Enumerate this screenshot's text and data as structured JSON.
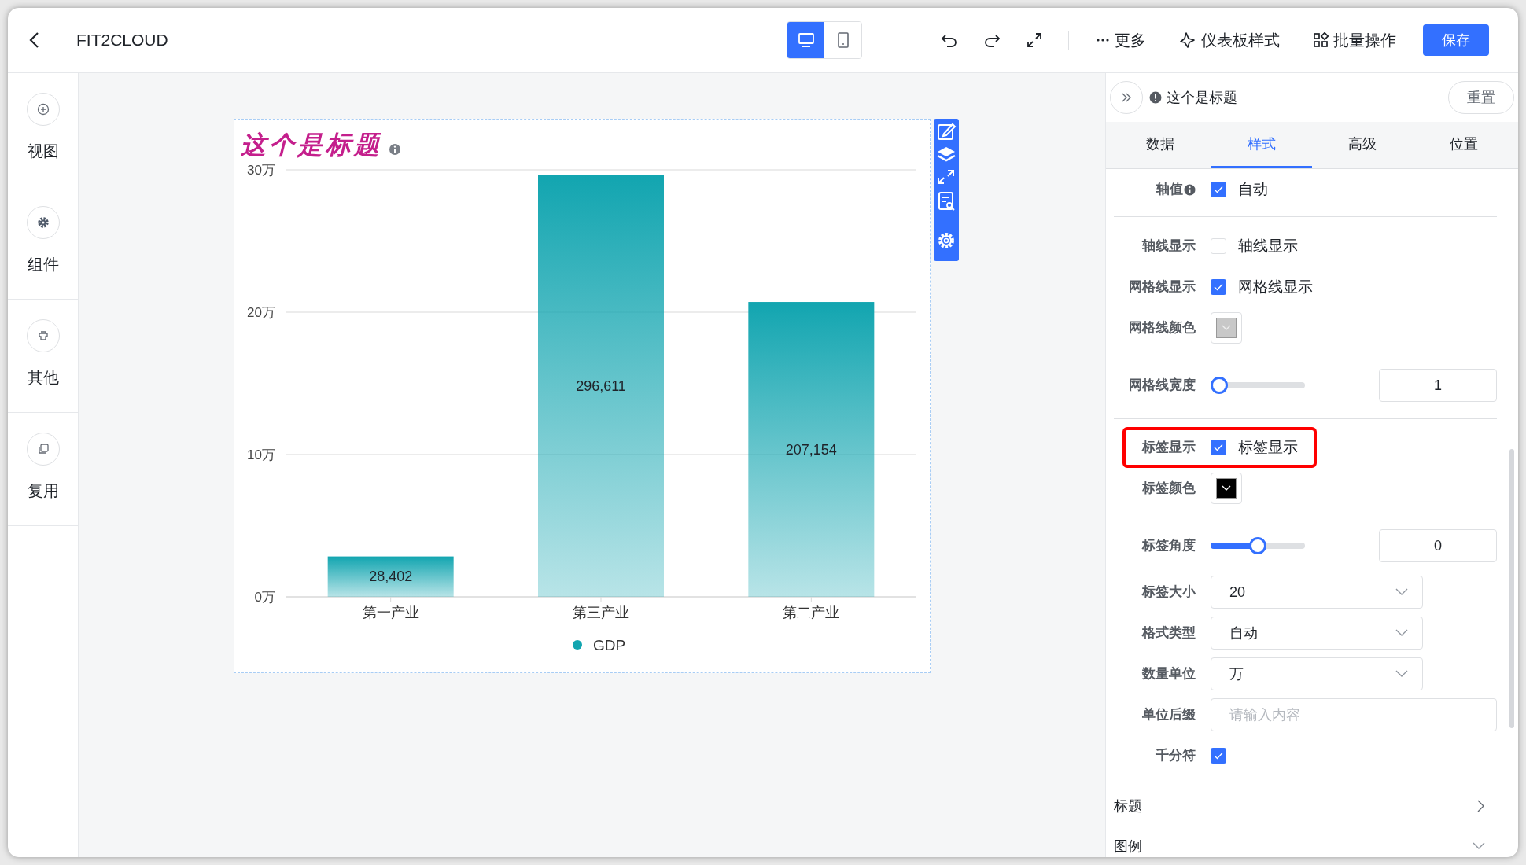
{
  "header": {
    "title": "FIT2CLOUD",
    "device_modes": [
      {
        "kind": "desktop",
        "selected": true
      },
      {
        "kind": "mobile",
        "selected": false
      }
    ],
    "actions": [
      {
        "kind": "more",
        "label": "更多"
      },
      {
        "kind": "style",
        "label": "仪表板样式"
      },
      {
        "kind": "batch",
        "label": "批量操作"
      }
    ],
    "save_button": "保存"
  },
  "sidebar": {
    "items": [
      {
        "kind": "view",
        "label": "视图"
      },
      {
        "kind": "component",
        "label": "组件"
      },
      {
        "kind": "other",
        "label": "其他"
      },
      {
        "kind": "reuse",
        "label": "复用"
      }
    ]
  },
  "chart_card": {
    "chart_data": {
      "type": "bar",
      "title": "这个是标题",
      "categories": [
        "第一产业",
        "第三产业",
        "第二产业"
      ],
      "series": [
        {
          "name": "GDP",
          "color": "#12a5b0",
          "values": [
            2.8402,
            29.6611,
            20.7154
          ]
        }
      ],
      "ylim": [
        0,
        30
      ],
      "yticks": [
        {
          "value": 0,
          "label": "0万"
        },
        {
          "value": 10,
          "label": "10万"
        },
        {
          "value": 20,
          "label": "20万"
        },
        {
          "value": 30,
          "label": "30万"
        }
      ],
      "value_labels": [
        "28,402",
        "296,611",
        "207,154"
      ]
    }
  },
  "panel": {
    "title": "这个是标题",
    "reset_button": "重置",
    "tabs": [
      {
        "label": "数据",
        "selected": false
      },
      {
        "label": "样式",
        "selected": true
      },
      {
        "label": "高级",
        "selected": false
      },
      {
        "label": "位置",
        "selected": false
      }
    ],
    "groups": [
      [
        {
          "kind": "checkbox",
          "label": "轴值",
          "info": true,
          "checked": true,
          "text": "自动"
        }
      ],
      [
        {
          "kind": "checkbox",
          "label": "轴线显示",
          "checked": false,
          "text": "轴线显示"
        },
        {
          "kind": "checkbox",
          "label": "网格线显示",
          "checked": true,
          "text": "网格线显示"
        },
        {
          "kind": "color",
          "label": "网格线颜色",
          "color": "#c8c8c8"
        },
        {
          "kind": "slider",
          "label": "网格线宽度",
          "level": 0,
          "value": "1"
        }
      ],
      [
        {
          "kind": "checkbox",
          "label": "标签显示",
          "checked": true,
          "text": "标签显示",
          "highlighted": true
        },
        {
          "kind": "color",
          "label": "标签颜色",
          "color": "#000000"
        },
        {
          "kind": "slider",
          "label": "标签角度",
          "level": 0.5,
          "value": "0"
        },
        {
          "kind": "select",
          "label": "标签大小",
          "value": "20"
        },
        {
          "kind": "select",
          "label": "格式类型",
          "value": "自动"
        },
        {
          "kind": "select",
          "label": "数量单位",
          "value": "万"
        },
        {
          "kind": "input",
          "label": "单位后缀",
          "placeholder": "请输入内容"
        },
        {
          "kind": "checkbox",
          "label": "千分符",
          "checked": true
        }
      ]
    ],
    "sections": [
      {
        "label": "标题",
        "expanded": false
      },
      {
        "label": "图例",
        "expanded": true
      }
    ]
  }
}
